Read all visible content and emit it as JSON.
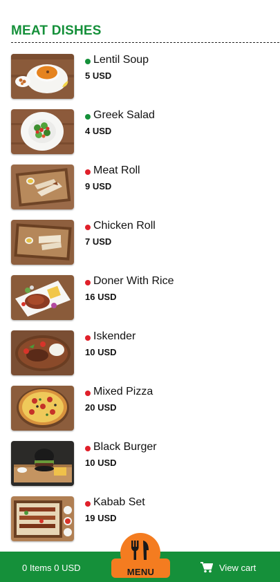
{
  "section": {
    "title": "MEAT DISHES"
  },
  "items": [
    {
      "name": "Lentil Soup",
      "price": "5 USD",
      "dot_color": "#15903a",
      "icon": "lentil-soup-photo"
    },
    {
      "name": "Greek Salad",
      "price": "4 USD",
      "dot_color": "#15903a",
      "icon": "greek-salad-photo"
    },
    {
      "name": "Meat Roll",
      "price": "9 USD",
      "dot_color": "#e0202a",
      "icon": "meat-roll-photo"
    },
    {
      "name": "Chicken Roll",
      "price": "7 USD",
      "dot_color": "#e0202a",
      "icon": "chicken-roll-photo"
    },
    {
      "name": "Doner With Rice",
      "price": "16 USD",
      "dot_color": "#e0202a",
      "icon": "doner-rice-photo"
    },
    {
      "name": "Iskender",
      "price": "10 USD",
      "dot_color": "#e0202a",
      "icon": "iskender-photo"
    },
    {
      "name": "Mixed Pizza",
      "price": "20 USD",
      "dot_color": "#e0202a",
      "icon": "pizza-photo"
    },
    {
      "name": "Black Burger",
      "price": "10 USD",
      "dot_color": "#e0202a",
      "icon": "burger-photo"
    },
    {
      "name": "Kabab Set",
      "price": "19 USD",
      "dot_color": "#e0202a",
      "icon": "kabab-photo"
    }
  ],
  "bottom_bar": {
    "cart_summary": "0 Items 0 USD",
    "menu_label": "MENU",
    "view_cart_label": "View cart"
  },
  "colors": {
    "brand_green": "#15903a",
    "accent_orange": "#f47c20"
  }
}
